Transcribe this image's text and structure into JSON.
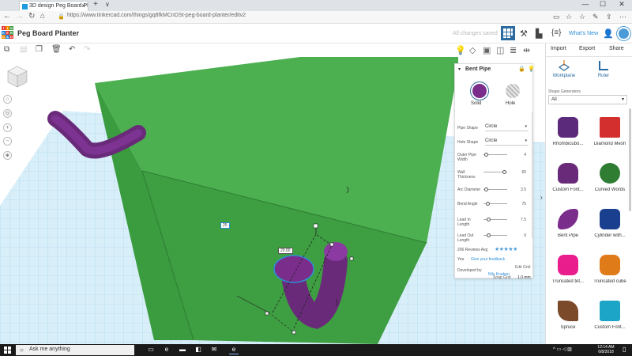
{
  "browser": {
    "tab_title": "3D design Peg Board Pl",
    "tab_close": "×",
    "new_tab": "+",
    "tab_dropdown": "∨",
    "win_min": "—",
    "win_max": "☐",
    "win_close": "✕",
    "url": "https://www.tinkercad.com/things/gq8fkMCnDSt-peg-board-planter/editv2"
  },
  "header": {
    "logo_letters": [
      "T",
      "I",
      "N",
      "K",
      "E",
      "R",
      "C",
      "A",
      "D"
    ],
    "design_title": "Peg Board Planter",
    "save_status": "All changes saved",
    "whats_new": "What's New"
  },
  "right_panel": {
    "import": "Import",
    "export": "Export",
    "share": "Share",
    "workplane": "Workplane",
    "ruler": "Ruler",
    "shape_generators_label": "Shape Generators",
    "shape_filter": "All",
    "shapes": [
      {
        "label": "Rhombicubo...",
        "color": "#5b2a7a"
      },
      {
        "label": "Diamond Mesh",
        "color": "#d32f2f"
      },
      {
        "label": "Custom Font...",
        "color": "#6a2a7a"
      },
      {
        "label": "Curved Words",
        "color": "#2e7d32"
      },
      {
        "label": "Bent Pipe",
        "color": "#7b2d8b"
      },
      {
        "label": "Cylinder with...",
        "color": "#1a3f8f"
      },
      {
        "label": "Truncated tet...",
        "color": "#e91e8c"
      },
      {
        "label": "Truncated cube",
        "color": "#e07b1a"
      },
      {
        "label": "Spruce",
        "color": "#7a4a2a"
      },
      {
        "label": "Custom Font...",
        "color": "#1da5c8"
      }
    ]
  },
  "inspector": {
    "title": "Bent Pipe",
    "solid": "Solid",
    "hole": "Hole",
    "pipe_shape_label": "Pipe Shape",
    "pipe_shape_value": "Circle",
    "hole_shape_label": "Hole Shape",
    "hole_shape_value": "Circle",
    "sliders": [
      {
        "label": "Outer Pipe Width",
        "value": "4",
        "pos": 0.05
      },
      {
        "label": "Wall Thickness",
        "value": "60",
        "pos": 0.9
      },
      {
        "label": "Arc Diameter",
        "value": "3.5",
        "pos": 0.05
      },
      {
        "label": "Bend Angle",
        "value": "75",
        "pos": 0.1
      },
      {
        "label": "Lead In Length",
        "value": "7.5",
        "pos": 0.15
      },
      {
        "label": "Lead Out Length",
        "value": "9",
        "pos": 0.15
      }
    ],
    "reviews": "206 Reviews Avg",
    "stars": "★★★★★",
    "you_label": "You",
    "feedback": "Give your feedback",
    "developed_by": "Developed by",
    "author": "Nils Knaben"
  },
  "viewport": {
    "edit_grid": "Edit Grid",
    "snap_grid_label": "Snap Grid",
    "snap_grid_value": "1.0 mm",
    "dim1": "25",
    "dim2": "20.00"
  },
  "taskbar": {
    "search_placeholder": "Ask me anything",
    "time": "12:14 AM",
    "date": "6/8/2018"
  }
}
